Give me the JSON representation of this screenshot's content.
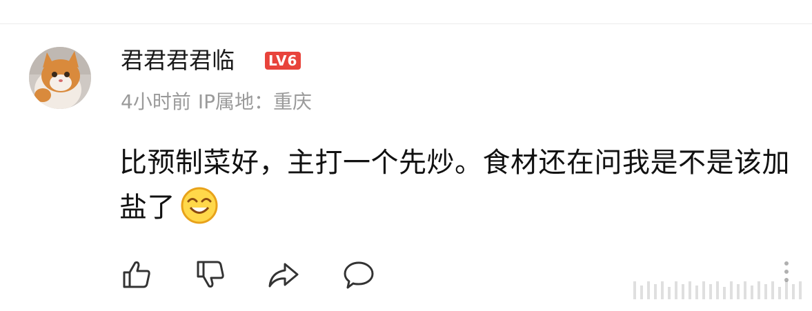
{
  "comment_card": {
    "username": "君君君君临",
    "level_badge": "LV6",
    "meta": {
      "time": "4小时前",
      "ip_location": "IP属地：重庆"
    },
    "text": "比预制菜好，主打一个先炒。食材还在问我是不是该加盐了",
    "emoji": "grinning-face-icon",
    "actions": [
      "thumbs-up-icon",
      "thumbs-down-icon",
      "share-arrow-icon",
      "comment-bubble-icon",
      "more-vertical-icon"
    ]
  },
  "colors": {
    "badge": "#e8433b",
    "meta_text": "#9a9a9a",
    "body_text": "#111111",
    "icon": "#333333"
  }
}
